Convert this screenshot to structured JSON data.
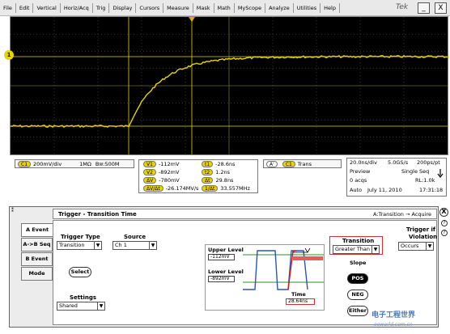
{
  "menu": {
    "items": [
      "File",
      "Edit",
      "Vertical",
      "Horiz/Acq",
      "Trig",
      "Display",
      "Cursors",
      "Measure",
      "Mask",
      "Math",
      "MyScope",
      "Analyze",
      "Utilities",
      "Help"
    ],
    "brand": "Tek",
    "minimize": "_",
    "close": "X"
  },
  "graticule": {
    "ch1_marker": "1",
    "trace_color": "#e8d400",
    "grid_color": "#6d6d2a"
  },
  "readouts": {
    "channel": {
      "badge": "C1",
      "scale": "200mV/div",
      "impedance": "1MΩ",
      "bw": "B",
      "bw_sub": "W",
      "bw_value": ":500M"
    },
    "measurements": [
      {
        "badge": "V1",
        "value": "-112mV"
      },
      {
        "badge": "V2",
        "value": "-892mV"
      },
      {
        "badge": "ΔV",
        "value": "-780mV"
      },
      {
        "badge": "ΔV/Δt",
        "value": "-26.174MV/s"
      }
    ],
    "time_measurements": [
      {
        "badge": "t1",
        "value": "-28.6ns"
      },
      {
        "badge": "t2",
        "value": "1.2ns"
      },
      {
        "badge": "Δt",
        "value": "29.8ns"
      },
      {
        "badge": "1/Δt",
        "value": "33.557MHz"
      }
    ],
    "trigger": {
      "badge_a": "A'",
      "badge_c": "C1",
      "label": "Trans"
    },
    "acquisition": {
      "timebase": "20.0ns/div",
      "sample_rate": "5.0GS/s",
      "resolution": "200ps/pt",
      "mode": "Preview",
      "seq": "Single Seq",
      "acqs": "0 acqs",
      "rl": "RL:1.0k",
      "auto": "Auto",
      "date": "July 11, 2010",
      "time": "17:31:18"
    }
  },
  "dialog": {
    "title": "Trigger - Transition Time",
    "route": "A:Transition → Acquire",
    "tabs": [
      "A Event",
      "A->B Seq",
      "B Event",
      "Mode"
    ],
    "trigger_type_label": "Trigger Type",
    "trigger_type_value": "Transition",
    "source_label": "Source",
    "source_value": "Ch 1",
    "select_button": "Select",
    "settings_label": "Settings",
    "settings_value": "Shared",
    "upper_level_label": "Upper Level",
    "upper_level_value": "-112mV",
    "lower_level_label": "Lower Level",
    "lower_level_value": "-892mV",
    "time_label": "Time",
    "time_value": "28.64ns",
    "transition_label": "Transition",
    "transition_value": "Greater Than",
    "slope_label": "Slope",
    "slope_pos": "POS",
    "slope_neg": "NEG",
    "slope_either": "Either",
    "violation_label_1": "Trigger if",
    "violation_label_2": "Violation",
    "violation_value": "Occurs",
    "close": "X",
    "help_1": "?",
    "help_2": "?"
  },
  "watermark": {
    "line1": "电子工程世界",
    "line2": "eeworld.com.cn"
  }
}
